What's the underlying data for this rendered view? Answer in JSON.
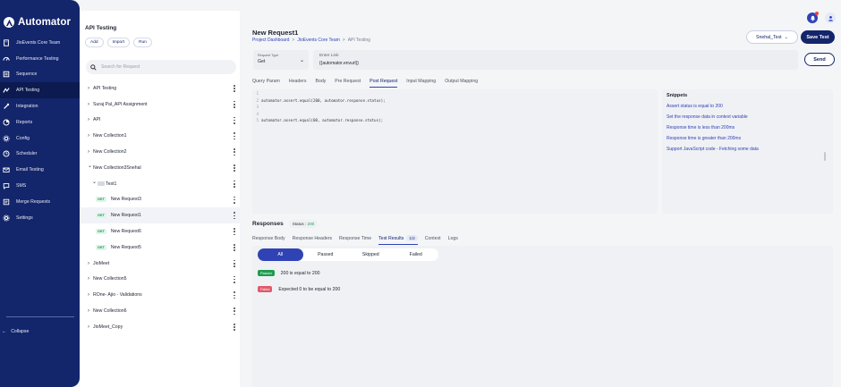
{
  "app": {
    "name": "Automator",
    "colors": {
      "sidebar": "#13256b",
      "accent": "#2f43b5",
      "pass": "#1e9c4f",
      "fail": "#e05a6a"
    }
  },
  "sidebar": {
    "items": [
      {
        "label": "JioEvents Core Team",
        "icon": "building-icon"
      },
      {
        "label": "Performance Testing",
        "icon": "gauge-icon"
      },
      {
        "label": "Sequence",
        "icon": "list-icon"
      },
      {
        "label": "API Testing",
        "icon": "api-icon",
        "active": true
      },
      {
        "label": "Integration",
        "icon": "wrench-icon"
      },
      {
        "label": "Reports",
        "icon": "reports-icon"
      },
      {
        "label": "Config",
        "icon": "config-icon"
      },
      {
        "label": "Scheduler",
        "icon": "clock-icon"
      },
      {
        "label": "Email Testing",
        "icon": "mail-icon"
      },
      {
        "label": "SMS",
        "icon": "sms-icon"
      },
      {
        "label": "Merge Requests",
        "icon": "merge-icon"
      },
      {
        "label": "Settings",
        "icon": "gear-icon"
      }
    ],
    "collapse_label": "Collapse"
  },
  "collections": {
    "title": "API Testing",
    "actions": {
      "add": "Add",
      "import": "Import",
      "run": "Run"
    },
    "search_placeholder": "Search for Request",
    "tree": [
      {
        "label": "API Testing",
        "level": 0,
        "type": "collection"
      },
      {
        "label": "Suraj Pal_API Assignment",
        "level": 0,
        "type": "collection"
      },
      {
        "label": "API",
        "level": 0,
        "type": "collection"
      },
      {
        "label": "New Collection1",
        "level": 0,
        "type": "collection"
      },
      {
        "label": "New Collection2",
        "level": 0,
        "type": "collection"
      },
      {
        "label": "New Collection3Snehal",
        "level": 0,
        "type": "collection",
        "expanded": true
      },
      {
        "label": "Test1",
        "level": 1,
        "type": "folder",
        "expanded": true
      },
      {
        "label": "New Request3",
        "level": 2,
        "type": "request",
        "method": "GET"
      },
      {
        "label": "New Request1",
        "level": 2,
        "type": "request",
        "method": "GET",
        "active": true
      },
      {
        "label": "New Request6",
        "level": 2,
        "type": "request",
        "method": "GET"
      },
      {
        "label": "New Request5",
        "level": 2,
        "type": "request",
        "method": "GET"
      },
      {
        "label": "JioMeet",
        "level": 0,
        "type": "collection"
      },
      {
        "label": "New Collection5",
        "level": 0,
        "type": "collection"
      },
      {
        "label": "ROne- Ajio - Validations",
        "level": 0,
        "type": "collection"
      },
      {
        "label": "New Collection6",
        "level": 0,
        "type": "collection"
      },
      {
        "label": "JioMeet_Copy",
        "level": 0,
        "type": "collection"
      }
    ]
  },
  "header": {
    "title": "New Request1",
    "breadcrumb": [
      "Project Dashboard",
      "JioEvents Core Team",
      "API Testing"
    ],
    "env_label": "Snehal_Test",
    "save_label": "Save Test"
  },
  "request": {
    "type_label": "Request Type",
    "type_value": "Get",
    "link_label": "Enter Link",
    "link_value": "{{automator.envurl}}",
    "send_label": "Send"
  },
  "tabs": [
    "Query Param",
    "Headers",
    "Body",
    "Pre Request",
    "Post Request",
    "Input Mapping",
    "Output Mapping"
  ],
  "active_tab": "Post Request",
  "editor": {
    "lines": [
      {
        "n": "1",
        "code": ""
      },
      {
        "n": "2",
        "code": "automator.assert.equal(200, automator.response.status);"
      },
      {
        "n": "3",
        "code": ""
      },
      {
        "n": "4",
        "code": ""
      },
      {
        "n": "5",
        "code": "automator.assert.equal(00, automator.response.status);"
      }
    ]
  },
  "snippets": {
    "title": "Snippets",
    "items": [
      "Assert status is equal to 200",
      "Set the response data in context variable",
      "Response time is less than 200ms",
      "Response time is greater than 200ms",
      "Support JavaScript code - Fetching some data"
    ]
  },
  "responses": {
    "title": "Responses",
    "status_label": "Status :",
    "status_value": "200",
    "tabs": [
      "Response Body",
      "Response Headers",
      "Response Time",
      "Test Results",
      "Context",
      "Logs"
    ],
    "active_tab": "Test Results",
    "test_count": "1/2",
    "filters": [
      "All",
      "Passed",
      "Skipped",
      "Failed"
    ],
    "active_filter": "All",
    "results": [
      {
        "status": "Passed",
        "message": "200 is equal to 200"
      },
      {
        "status": "Failed",
        "message": "Expected 0 to be equal to 200"
      }
    ]
  }
}
